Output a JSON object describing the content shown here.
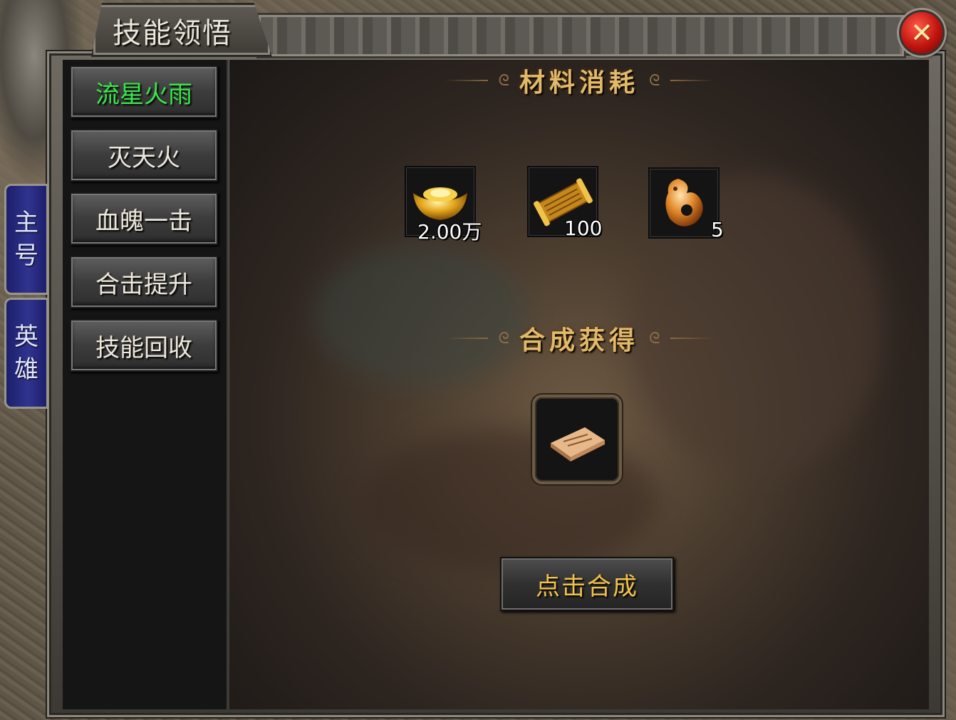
{
  "window": {
    "title": "技能领悟",
    "close_label": "✕"
  },
  "side_tabs": [
    {
      "label": [
        "主",
        "号"
      ]
    },
    {
      "label": [
        "英",
        "雄"
      ]
    }
  ],
  "skills": [
    {
      "label": "流星火雨",
      "active": true
    },
    {
      "label": "灭天火",
      "active": false
    },
    {
      "label": "血魄一击",
      "active": false
    },
    {
      "label": "合击提升",
      "active": false
    },
    {
      "label": "技能回收",
      "active": false
    }
  ],
  "materials": {
    "header": "材料消耗",
    "items": [
      {
        "icon": "gold-ingot-icon",
        "count": "2.00万"
      },
      {
        "icon": "scroll-icon",
        "count": "100"
      },
      {
        "icon": "jade-pendant-icon",
        "count": "5"
      }
    ]
  },
  "result": {
    "header": "合成获得",
    "item": {
      "icon": "skill-book-icon"
    }
  },
  "compose_button": {
    "label": "点击合成"
  },
  "colors": {
    "active_skill": "#39e64a",
    "header_gold": "#e3b969",
    "compose_text": "#f1c24a",
    "side_tab_blue": "#30348f"
  }
}
